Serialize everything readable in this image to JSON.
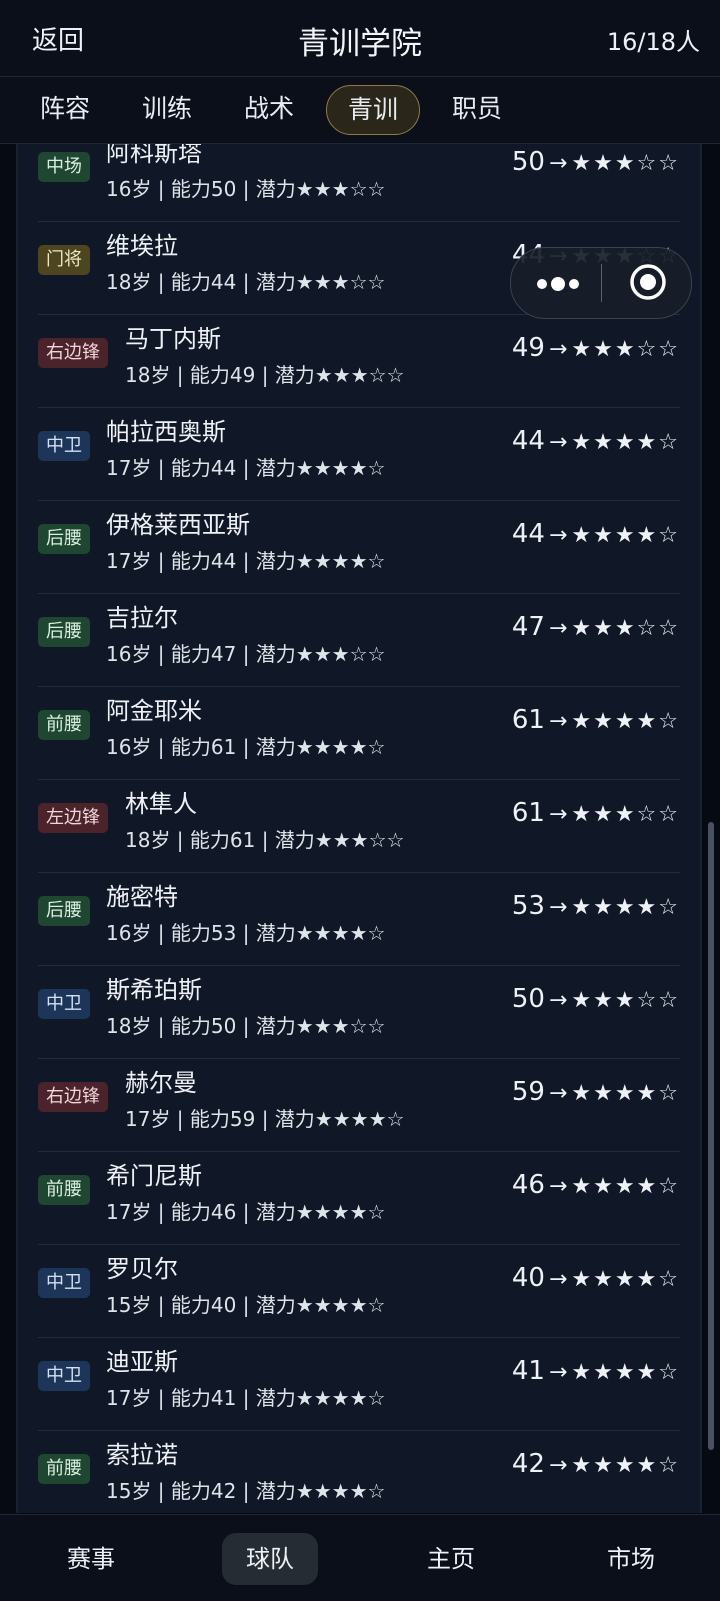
{
  "header": {
    "back_label": "返回",
    "title": "青训学院",
    "count": "16/18人"
  },
  "tabs": [
    {
      "label": "阵容",
      "active": false
    },
    {
      "label": "训练",
      "active": false
    },
    {
      "label": "战术",
      "active": false
    },
    {
      "label": "青训",
      "active": true
    },
    {
      "label": "职员",
      "active": false
    }
  ],
  "players": [
    {
      "position": "中场",
      "name": "阿科斯塔",
      "details": "16岁 | 能力50 | 潜力★★★☆☆",
      "ability": "50",
      "potential": "★★★☆☆"
    },
    {
      "position": "门将",
      "name": "维埃拉",
      "details": "18岁 | 能力44 | 潜力★★★☆☆",
      "ability": "44",
      "potential": "★★★☆☆"
    },
    {
      "position": "右边锋",
      "name": "马丁内斯",
      "details": "18岁 | 能力49 | 潜力★★★☆☆",
      "ability": "49",
      "potential": "★★★☆☆"
    },
    {
      "position": "中卫",
      "name": "帕拉西奥斯",
      "details": "17岁 | 能力44 | 潜力★★★★☆",
      "ability": "44",
      "potential": "★★★★☆"
    },
    {
      "position": "后腰",
      "name": "伊格莱西亚斯",
      "details": "17岁 | 能力44 | 潜力★★★★☆",
      "ability": "44",
      "potential": "★★★★☆"
    },
    {
      "position": "后腰",
      "name": "吉拉尔",
      "details": "16岁 | 能力47 | 潜力★★★☆☆",
      "ability": "47",
      "potential": "★★★☆☆"
    },
    {
      "position": "前腰",
      "name": "阿金耶米",
      "details": "16岁 | 能力61 | 潜力★★★★☆",
      "ability": "61",
      "potential": "★★★★☆"
    },
    {
      "position": "左边锋",
      "name": "林隼人",
      "details": "18岁 | 能力61 | 潜力★★★☆☆",
      "ability": "61",
      "potential": "★★★☆☆"
    },
    {
      "position": "后腰",
      "name": "施密特",
      "details": "16岁 | 能力53 | 潜力★★★★☆",
      "ability": "53",
      "potential": "★★★★☆"
    },
    {
      "position": "中卫",
      "name": "斯希珀斯",
      "details": "18岁 | 能力50 | 潜力★★★☆☆",
      "ability": "50",
      "potential": "★★★☆☆"
    },
    {
      "position": "右边锋",
      "name": "赫尔曼",
      "details": "17岁 | 能力59 | 潜力★★★★☆",
      "ability": "59",
      "potential": "★★★★☆"
    },
    {
      "position": "前腰",
      "name": "希门尼斯",
      "details": "17岁 | 能力46 | 潜力★★★★☆",
      "ability": "46",
      "potential": "★★★★☆"
    },
    {
      "position": "中卫",
      "name": "罗贝尔",
      "details": "15岁 | 能力40 | 潜力★★★★☆",
      "ability": "40",
      "potential": "★★★★☆"
    },
    {
      "position": "中卫",
      "name": "迪亚斯",
      "details": "17岁 | 能力41 | 潜力★★★★☆",
      "ability": "41",
      "potential": "★★★★☆"
    },
    {
      "position": "前腰",
      "name": "索拉诺",
      "details": "15岁 | 能力42 | 潜力★★★★☆",
      "ability": "42",
      "potential": "★★★★☆"
    }
  ],
  "arrow": "→",
  "bottom_nav": [
    {
      "label": "赛事",
      "active": false
    },
    {
      "label": "球队",
      "active": true
    },
    {
      "label": "主页",
      "active": false
    },
    {
      "label": "市场",
      "active": false
    }
  ],
  "capsule": {
    "more_icon": "more-dots-icon",
    "close_icon": "target-close-icon"
  },
  "colors": {
    "midfield_badge": "#1f4630",
    "goalkeeper_badge": "#4d4420",
    "winger_badge": "#4a232b",
    "centerback_badge": "#1d3558",
    "active_tab_border": "#8f7b46"
  }
}
